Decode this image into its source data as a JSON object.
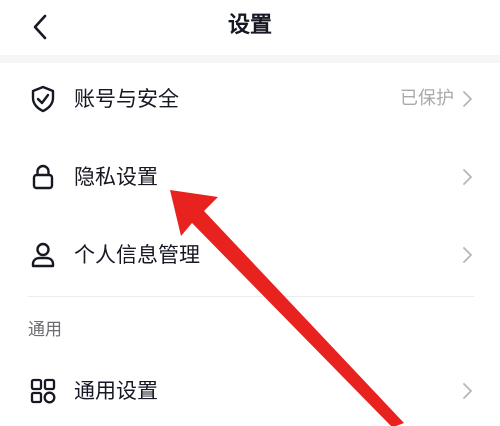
{
  "header": {
    "title": "设置",
    "back_icon": "chevron-left-icon"
  },
  "account_section": {
    "items": [
      {
        "label": "账号与安全",
        "value": "已保护",
        "icon": "shield-check-icon"
      },
      {
        "label": "隐私设置",
        "value": "",
        "icon": "lock-icon"
      },
      {
        "label": "个人信息管理",
        "value": "",
        "icon": "person-icon"
      }
    ]
  },
  "general_section": {
    "title": "通用",
    "items": [
      {
        "label": "通用设置",
        "value": "",
        "icon": "grid-icon"
      }
    ]
  },
  "annotation": {
    "arrow_color": "#e8231f"
  },
  "colors": {
    "text_primary": "#161823",
    "text_secondary": "#a8a9ad",
    "divider": "#ececee"
  }
}
